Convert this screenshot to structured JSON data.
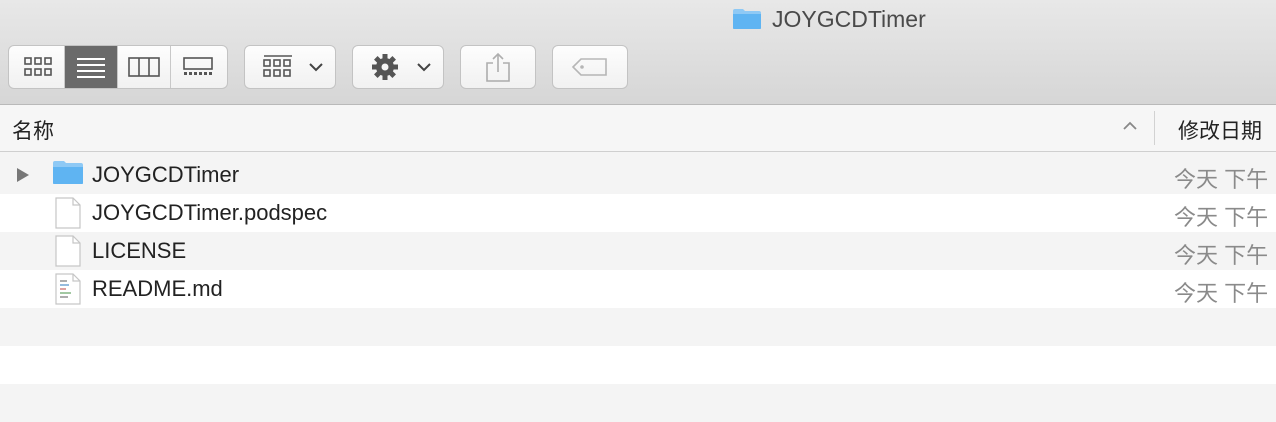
{
  "window": {
    "title": "JOYGCDTimer"
  },
  "toolbar": {
    "view_modes": [
      {
        "name": "icon-view",
        "icon": "grid-icon",
        "active": false
      },
      {
        "name": "list-view",
        "icon": "list-icon",
        "active": true
      },
      {
        "name": "column-view",
        "icon": "columns-icon",
        "active": false
      },
      {
        "name": "gallery-view",
        "icon": "gallery-icon",
        "active": false
      }
    ],
    "group_icon": "group-grid-icon",
    "action_icon": "gear-icon",
    "share_icon": "share-icon",
    "tags_icon": "tag-icon"
  },
  "columns": {
    "name_label": "名称",
    "date_label": "修改日期"
  },
  "files": [
    {
      "name": "JOYGCDTimer",
      "type": "folder",
      "date": "今天 下午"
    },
    {
      "name": "JOYGCDTimer.podspec",
      "type": "file",
      "date": "今天 下午"
    },
    {
      "name": "LICENSE",
      "type": "file",
      "date": "今天 下午"
    },
    {
      "name": "README.md",
      "type": "text-file",
      "date": "今天 下午"
    }
  ],
  "colors": {
    "folder_blue": "#5fb4f2",
    "active_segment": "#6a6a6a"
  }
}
